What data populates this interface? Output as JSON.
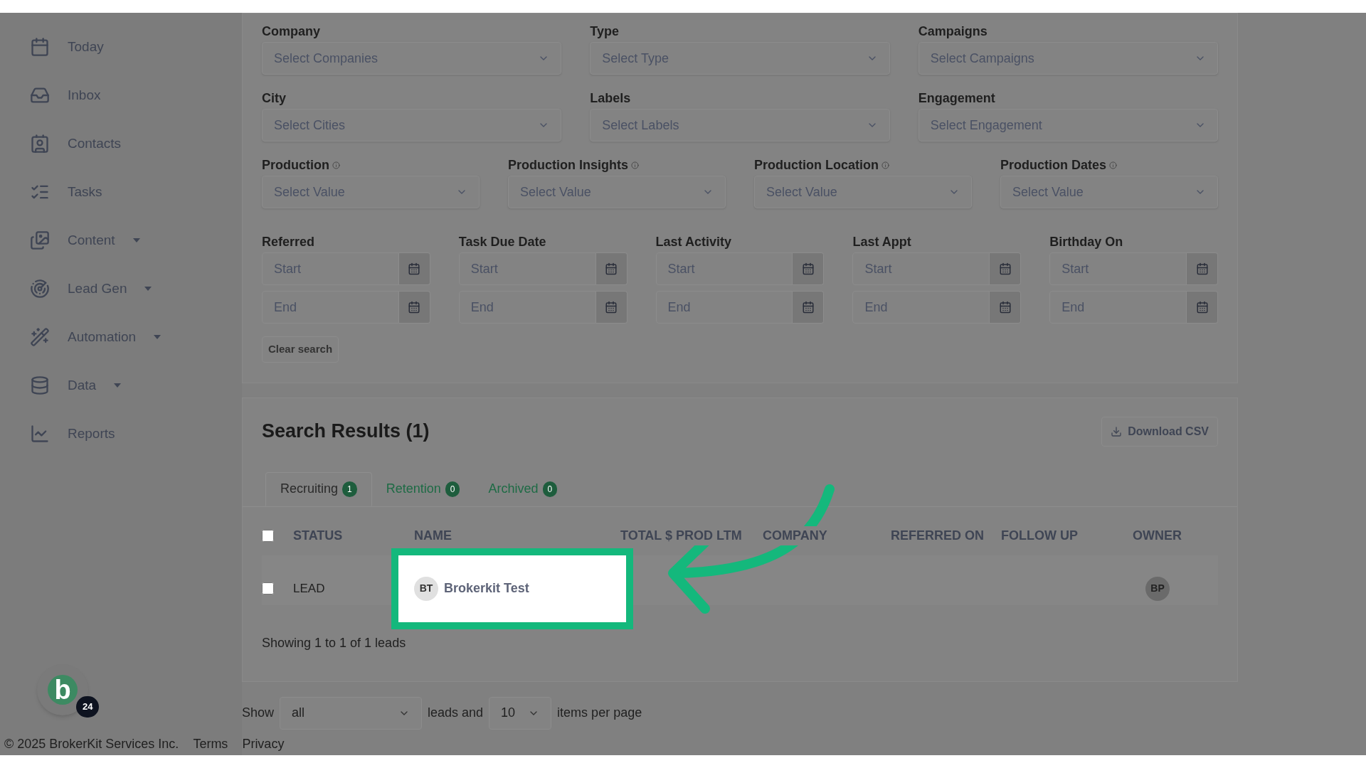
{
  "sidebar": {
    "items": [
      {
        "label": "Today",
        "dropdown": false
      },
      {
        "label": "Inbox",
        "dropdown": false
      },
      {
        "label": "Contacts",
        "dropdown": false
      },
      {
        "label": "Tasks",
        "dropdown": false
      },
      {
        "label": "Content",
        "dropdown": true
      },
      {
        "label": "Lead Gen",
        "dropdown": true
      },
      {
        "label": "Automation",
        "dropdown": true
      },
      {
        "label": "Data",
        "dropdown": true
      },
      {
        "label": "Reports",
        "dropdown": false
      }
    ]
  },
  "filters": {
    "select_rows": [
      [
        {
          "label": "Company",
          "placeholder": "Select Companies",
          "info": false
        },
        {
          "label": "Type",
          "placeholder": "Select Type",
          "info": false
        },
        {
          "label": "Campaigns",
          "placeholder": "Select Campaigns",
          "info": false
        }
      ],
      [
        {
          "label": "City",
          "placeholder": "Select Cities",
          "info": false
        },
        {
          "label": "Labels",
          "placeholder": "Select Labels",
          "info": false
        },
        {
          "label": "Engagement",
          "placeholder": "Select Engagement",
          "info": false
        }
      ],
      [
        {
          "label": "Production",
          "placeholder": "Select Value",
          "info": true
        },
        {
          "label": "Production Insights",
          "placeholder": "Select Value",
          "info": true
        },
        {
          "label": "Production Location",
          "placeholder": "Select Value",
          "info": true
        },
        {
          "label": "Production Dates",
          "placeholder": "Select Value",
          "info": true
        }
      ]
    ],
    "date_ranges": [
      {
        "label": "Referred",
        "start": "Start",
        "end": "End"
      },
      {
        "label": "Task Due Date",
        "start": "Start",
        "end": "End"
      },
      {
        "label": "Last Activity",
        "start": "Start",
        "end": "End"
      },
      {
        "label": "Last Appt",
        "start": "Start",
        "end": "End"
      },
      {
        "label": "Birthday On",
        "start": "Start",
        "end": "End"
      }
    ],
    "clear_button": "Clear search"
  },
  "results": {
    "title": "Search Results (1)",
    "download_button": "Download CSV",
    "tabs": [
      {
        "label": "Recruiting",
        "count": "1",
        "selected": true
      },
      {
        "label": "Retention",
        "count": "0",
        "selected": false
      },
      {
        "label": "Archived",
        "count": "0",
        "selected": false
      }
    ],
    "columns": [
      "STATUS",
      "NAME",
      "TOTAL $ PROD LTM",
      "COMPANY",
      "REFERRED ON",
      "FOLLOW UP",
      "OWNER"
    ],
    "all_checked": false,
    "rows": [
      {
        "checked": false,
        "status": "LEAD",
        "initials": "BT",
        "name": "Brokerkit Test",
        "highlighted": true,
        "owner": "BP"
      }
    ],
    "summary": "Showing 1 to 1 of 1 leads"
  },
  "pagination": {
    "show_label": "Show",
    "show_value": "all",
    "middle_label": "leads and",
    "per_page": "10",
    "per_page_label": "items per page"
  },
  "chat": {
    "logo_letter": "b",
    "count": "24"
  },
  "footer": {
    "copyright": "© 2025 BrokerKit Services Inc.",
    "links": [
      "Terms",
      "Privacy"
    ]
  }
}
